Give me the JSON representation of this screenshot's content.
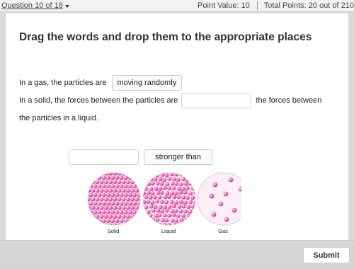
{
  "header": {
    "question_label": "Question 10 of 18",
    "point_value": "Point Value: 10",
    "total_points": "Total Points: 20 out of 210"
  },
  "prompt": {
    "title": "Drag the words and drop them to the appropriate places"
  },
  "sentences": {
    "line1_text": "In a gas, the particles are",
    "line1_answer": "moving randomly",
    "line2_text_before": "In a solid, the forces between the particles are",
    "line2_text_after": "the forces between",
    "line3_text": "the particles in a liquid."
  },
  "word_bank": {
    "chip_label": "stronger than"
  },
  "figure": {
    "labels": [
      "Solid",
      "Liquid",
      "Gas"
    ],
    "particle_color": "#e86fb6"
  },
  "footer": {
    "submit_label": "Submit"
  }
}
